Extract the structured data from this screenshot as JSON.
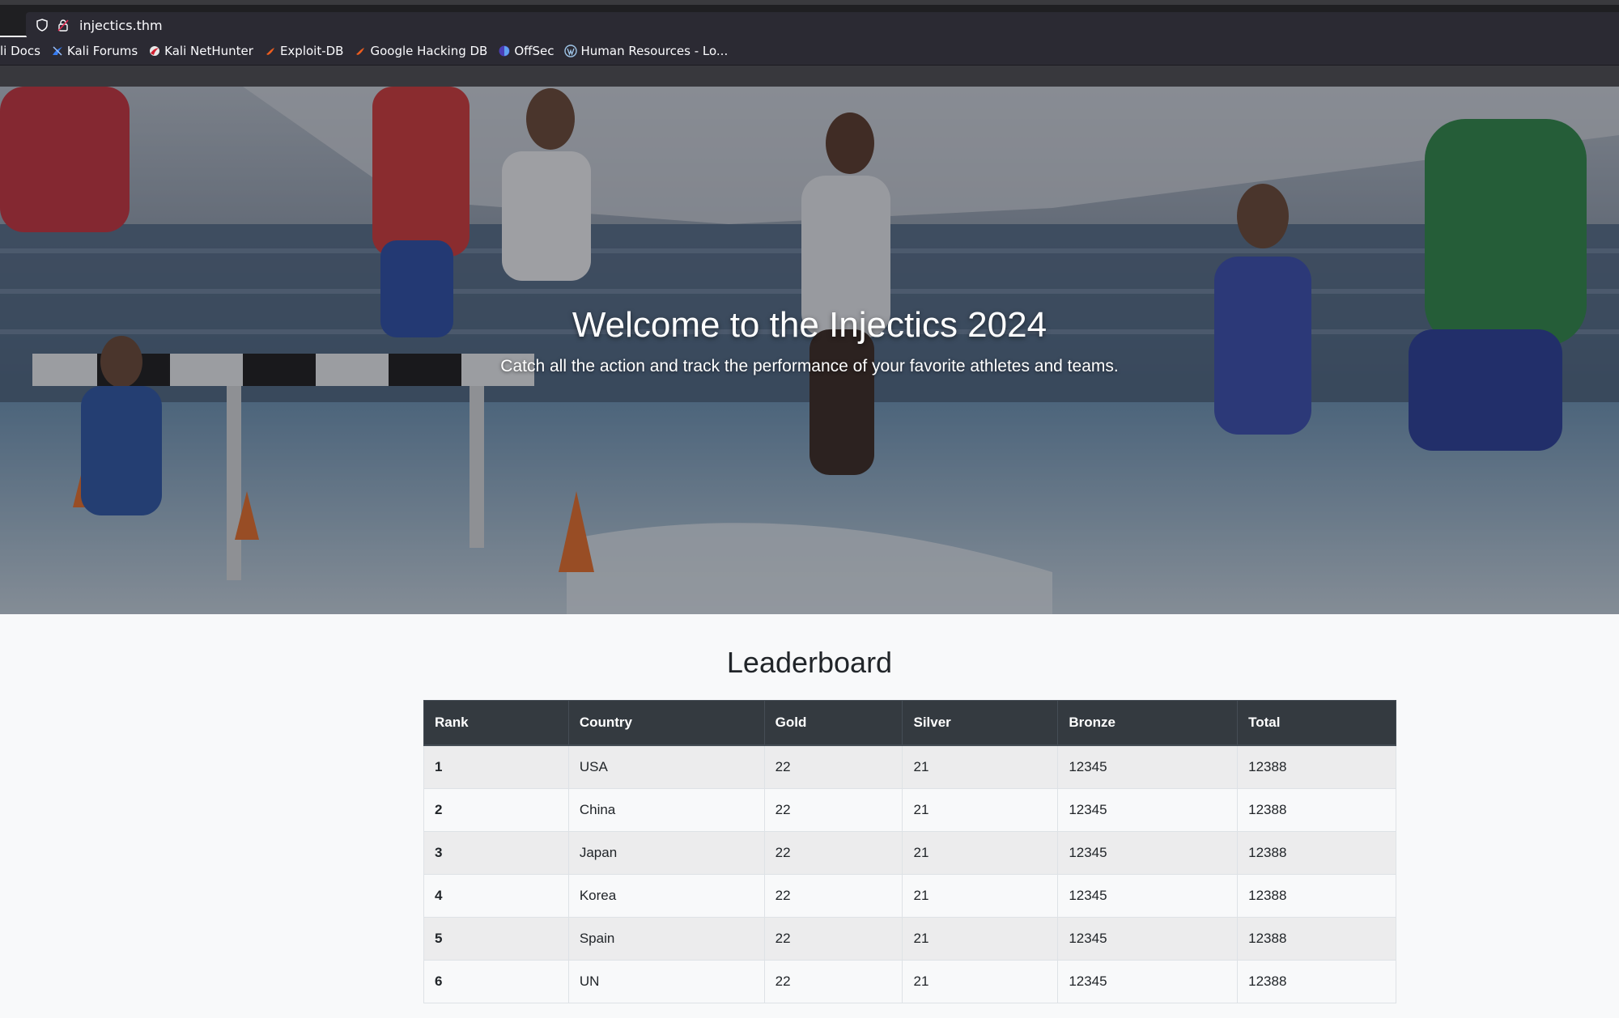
{
  "browser": {
    "url": "injectics.thm",
    "bookmarks": [
      {
        "label": "li Docs",
        "icon": "kali-docs-icon"
      },
      {
        "label": "Kali Forums",
        "icon": "kali-forums-icon"
      },
      {
        "label": "Kali NetHunter",
        "icon": "nethunter-icon"
      },
      {
        "label": "Exploit-DB",
        "icon": "exploit-db-icon"
      },
      {
        "label": "Google Hacking DB",
        "icon": "ghdb-icon"
      },
      {
        "label": "OffSec",
        "icon": "offsec-icon"
      },
      {
        "label": "Human Resources - Lo...",
        "icon": "wordpress-icon"
      }
    ]
  },
  "hero": {
    "title": "Welcome to the Injectics 2024",
    "subtitle": "Catch all the action and track the performance of your favorite athletes and teams."
  },
  "leaderboard": {
    "title": "Leaderboard",
    "headers": [
      "Rank",
      "Country",
      "Gold",
      "Silver",
      "Bronze",
      "Total"
    ],
    "rows": [
      {
        "rank": "1",
        "country": "USA",
        "gold": "22",
        "silver": "21",
        "bronze": "12345",
        "total": "12388"
      },
      {
        "rank": "2",
        "country": "China",
        "gold": "22",
        "silver": "21",
        "bronze": "12345",
        "total": "12388"
      },
      {
        "rank": "3",
        "country": "Japan",
        "gold": "22",
        "silver": "21",
        "bronze": "12345",
        "total": "12388"
      },
      {
        "rank": "4",
        "country": "Korea",
        "gold": "22",
        "silver": "21",
        "bronze": "12345",
        "total": "12388"
      },
      {
        "rank": "5",
        "country": "Spain",
        "gold": "22",
        "silver": "21",
        "bronze": "12345",
        "total": "12388"
      },
      {
        "rank": "6",
        "country": "UN",
        "gold": "22",
        "silver": "21",
        "bronze": "12345",
        "total": "12388"
      }
    ]
  },
  "colors": {
    "header_bg": "#343a40",
    "row_stripe": "#ececed",
    "page_bg": "#f8f9fa"
  }
}
